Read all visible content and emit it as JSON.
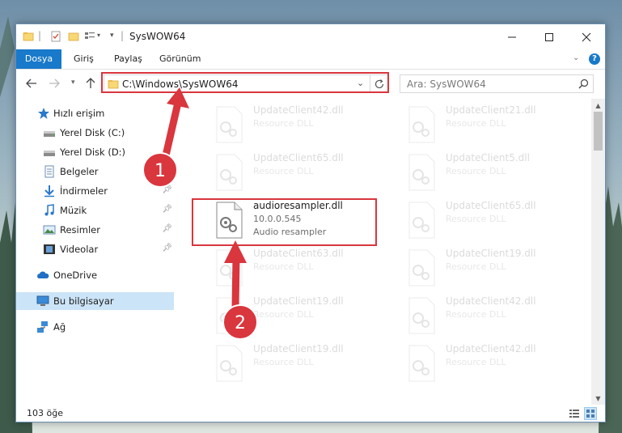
{
  "window": {
    "title": "SysWOW64"
  },
  "ribbon": {
    "tabs": [
      {
        "label": "Dosya"
      },
      {
        "label": "Giriş"
      },
      {
        "label": "Paylaş"
      },
      {
        "label": "Görünüm"
      }
    ]
  },
  "address": {
    "path": "C:\\Windows\\SysWOW64"
  },
  "search": {
    "placeholder": "Ara: SysWOW64"
  },
  "sidebar": {
    "items": [
      {
        "label": "Hızlı erişim",
        "icon": "star-icon"
      },
      {
        "label": "Yerel Disk (C:)",
        "icon": "drive-icon"
      },
      {
        "label": "Yerel Disk (D:)",
        "icon": "drive-icon"
      },
      {
        "label": "Belgeler",
        "icon": "documents-icon"
      },
      {
        "label": "İndirmeler",
        "icon": "download-icon",
        "pinned": true
      },
      {
        "label": "Müzik",
        "icon": "music-icon",
        "pinned": true
      },
      {
        "label": "Resimler",
        "icon": "pictures-icon",
        "pinned": true
      },
      {
        "label": "Videolar",
        "icon": "videos-icon",
        "pinned": true
      },
      {
        "label": "OneDrive",
        "icon": "cloud-icon"
      },
      {
        "label": "Bu bilgisayar",
        "icon": "computer-icon",
        "selected": true
      },
      {
        "label": "Ağ",
        "icon": "network-icon"
      }
    ]
  },
  "files": {
    "left": [
      {
        "name": "UpdateClient42.dll",
        "desc": "Resource DLL"
      },
      {
        "name": "UpdateClient65.dll",
        "desc": "Resource DLL"
      },
      {
        "name": "audioresampler.dll",
        "version": "10.0.0.545",
        "desc": "Audio resampler",
        "highlighted": true
      },
      {
        "name": "UpdateClient63.dll",
        "desc": "Resource DLL"
      },
      {
        "name": "UpdateClient19.dll",
        "desc": "Resource DLL"
      },
      {
        "name": "UpdateClient19.dll",
        "desc": "Resource DLL"
      }
    ],
    "right": [
      {
        "name": "UpdateClient21.dll",
        "desc": "Resource DLL"
      },
      {
        "name": "UpdateClient5.dll",
        "desc": "Resource DLL"
      },
      {
        "name": "UpdateClient65.dll",
        "desc": "Resource DLL"
      },
      {
        "name": "UpdateClient19.dll",
        "desc": "Resource DLL"
      },
      {
        "name": "UpdateClient42.dll",
        "desc": "Resource DLL"
      },
      {
        "name": "UpdateClient42.dll",
        "desc": "Resource DLL"
      }
    ]
  },
  "status": {
    "count": "103 öğe"
  },
  "annotations": {
    "marker1": "1",
    "marker2": "2",
    "color": "#d9363e"
  },
  "colors": {
    "accent": "#1979ca",
    "selection": "#cce4f7",
    "folder": "#f8d775"
  }
}
